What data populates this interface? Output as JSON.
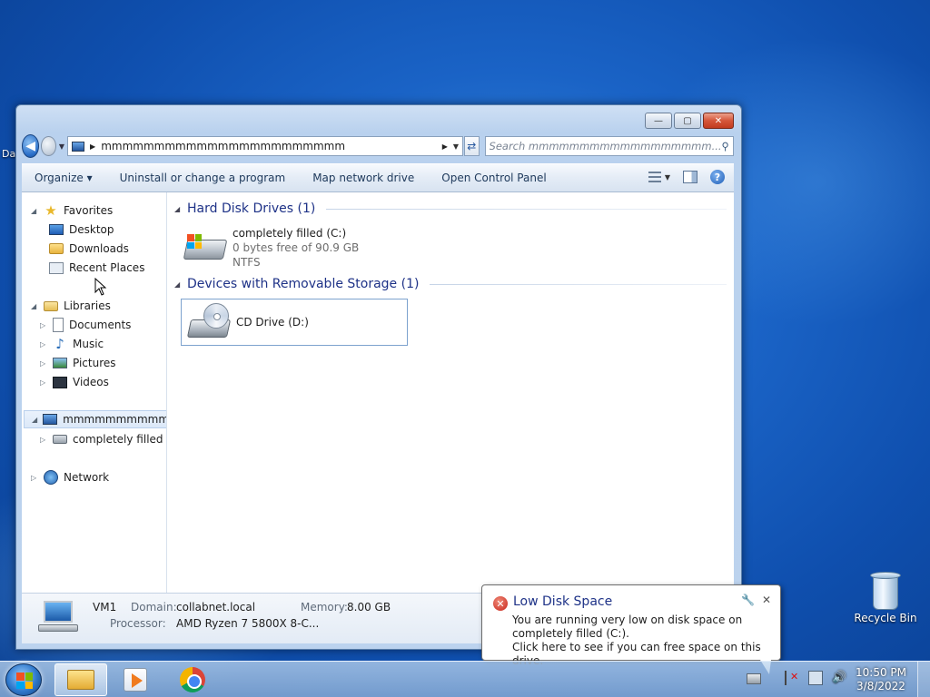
{
  "desktop": {
    "left_fragment": "Da",
    "recycle_bin_label": "Recycle Bin"
  },
  "window": {
    "buttons": {
      "minimize": "—",
      "maximize": "▢",
      "close": "✕"
    },
    "address": {
      "path": "mmmmmmmmmmmmmmmmmmmmmmm"
    },
    "search": {
      "placeholder": "Search mmmmmmmmmmmmmmmmmm..."
    },
    "toolbar": {
      "organize": "Organize ▾",
      "uninstall": "Uninstall or change a program",
      "map_drive": "Map network drive",
      "control_panel": "Open Control Panel"
    },
    "navpane": {
      "favorites": "Favorites",
      "desktop": "Desktop",
      "downloads": "Downloads",
      "recent_places": "Recent Places",
      "libraries": "Libraries",
      "documents": "Documents",
      "music": "Music",
      "pictures": "Pictures",
      "videos": "Videos",
      "computer": "mmmmmmmmmmmmmm",
      "drive_c": "completely filled (C:)",
      "network": "Network"
    },
    "content": {
      "hdd_group": "Hard Disk Drives (1)",
      "drive_c": {
        "name": "completely filled (C:)",
        "free": "0 bytes free of 90.9 GB",
        "fs": "NTFS"
      },
      "removable_group": "Devices with Removable Storage (1)",
      "drive_d": {
        "name": "CD Drive (D:)"
      }
    },
    "details": {
      "name": "VM1",
      "domain_label": "Domain:",
      "domain": "collabnet.local",
      "memory_label": "Memory:",
      "memory": "8.00 GB",
      "processor_label": "Processor:",
      "processor": "AMD Ryzen 7 5800X 8-C..."
    }
  },
  "balloon": {
    "title": "Low Disk Space",
    "message_1": "You are running very low on disk space on completely filled (C:).",
    "message_2": "Click here to see if you can free space on this drive.",
    "close": "✕"
  },
  "taskbar": {
    "time": "10:50 PM",
    "date": "3/8/2022"
  }
}
